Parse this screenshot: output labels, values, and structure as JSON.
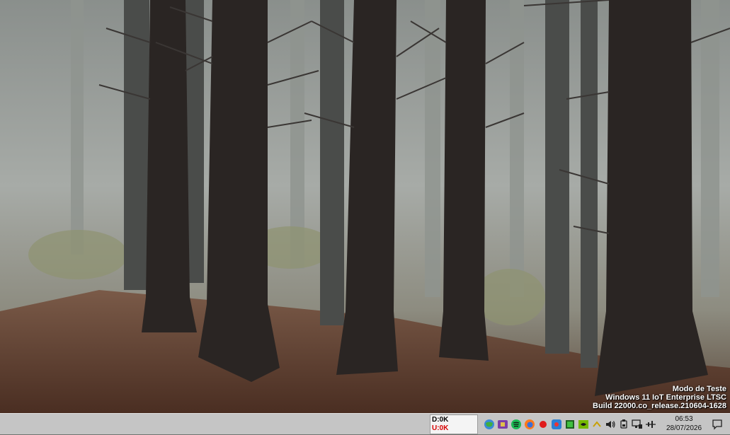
{
  "desktop": {
    "wallpaper": "foggy-forest",
    "watermark": {
      "line1": "Modo de Teste",
      "line2": "Windows 11 IoT Enterprise LTSC",
      "line3": "Build 22000.co_release.210604-1628"
    }
  },
  "taskbar": {
    "disk_monitor": {
      "read": "D:0K",
      "write": "U:0K"
    },
    "tray_icons": [
      "network-globe-icon",
      "app-purple-icon",
      "spotify-icon",
      "firefox-icon",
      "record-icon",
      "app-blue-icon",
      "app-green-icon",
      "nvidia-icon",
      "expand-tray-icon",
      "volume-icon",
      "usb-eject-icon",
      "display-network-icon",
      "battery-power-icon"
    ],
    "clock": {
      "time": "06:53",
      "date": "28/07/2026"
    },
    "notification_icon": "notification-icon"
  },
  "colors": {
    "taskbar_bg": "#c5c5c5",
    "upload_red": "#d60000",
    "spotify_green": "#1db954",
    "nvidia_green": "#76b900"
  }
}
